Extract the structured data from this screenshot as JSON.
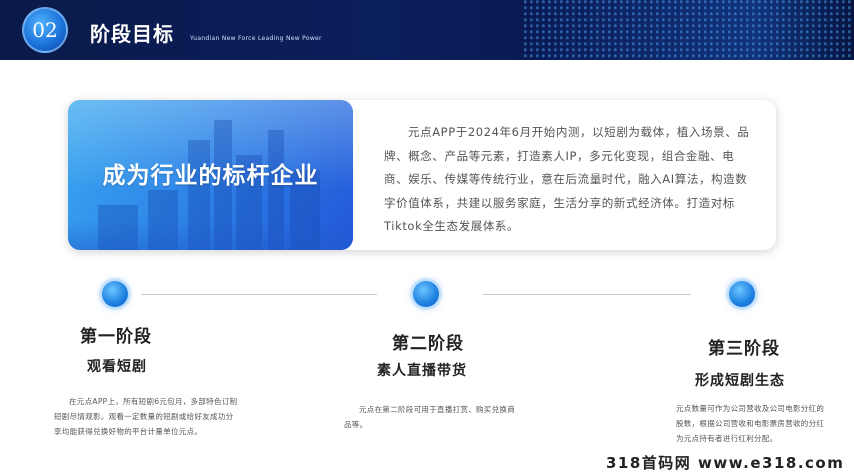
{
  "header": {
    "badge": "02",
    "title": "阶段目标",
    "subtitle": "Yuandian New Force Leading New Power"
  },
  "intro": {
    "slogan": "成为行业的标杆企业",
    "text": "元点APP于2024年6月开始内测，以短剧为载体，植入场景、品牌、概念、产品等元素，打造素人IP，多元化变现，组合金融、电商、娱乐、传媒等传统行业，意在后流量时代，融入AI算法，构造数字价值体系，共建以服务家庭，生活分享的新式经济体。打造对标Tiktok全生态发展体系。"
  },
  "stages": [
    {
      "title": "第一阶段",
      "subtitle": "观看短剧",
      "desc": "在元点APP上，所有短剧6元包月，多部特色订制短剧尽情观影。观看一定数量的短剧或给好友成功分享均能获得兑换好物的平台计量单位元点。"
    },
    {
      "title": "第二阶段",
      "subtitle": "素人直播带货",
      "desc": "元点在第二阶段可用于直播打赏、购买兑换商品等。"
    },
    {
      "title": "第三阶段",
      "subtitle": "形成短剧生态",
      "desc": "元点数量可作为公司营收及公司电影分红的股数，根据公司营收和电影票房营收的分红为元点持有者进行红利分配。"
    }
  ],
  "watermark": "318首码网 www.e318.com",
  "colors": {
    "header_bg": "#0b1f5c",
    "accent": "#1c7fe0"
  }
}
